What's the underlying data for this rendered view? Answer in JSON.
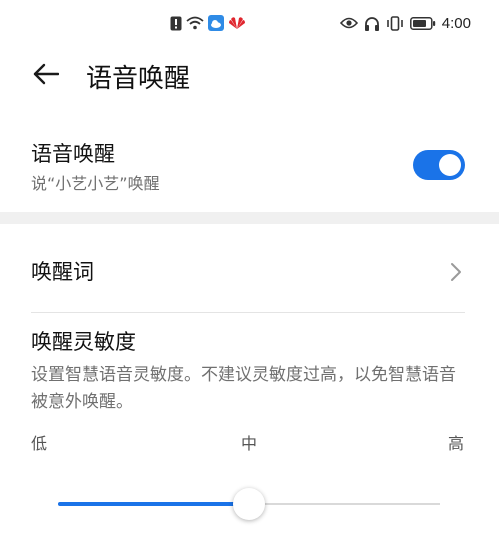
{
  "status_bar": {
    "time": "4:00",
    "left_icons": [
      "alert-card-icon",
      "wifi-icon",
      "weather-app-icon",
      "huawei-logo-icon"
    ],
    "right_icons": [
      "eye-comfort-icon",
      "headphones-icon",
      "vibrate-icon",
      "battery-icon"
    ]
  },
  "header": {
    "title": "语音唤醒",
    "back_icon": "arrow-left-icon"
  },
  "voice_wakeup": {
    "title": "语音唤醒",
    "subtitle": "说“小艺小艺”唤醒",
    "enabled": true,
    "accent_color": "#1a73e8"
  },
  "wake_word": {
    "label": "唤醒词",
    "chevron_icon": "chevron-right-icon"
  },
  "sensitivity": {
    "title": "唤醒灵敏度",
    "description": "设置智慧语音灵敏度。不建议灵敏度过高，以免智慧语音被意外唤醒。",
    "levels": [
      "低",
      "中",
      "高"
    ],
    "value_fraction": 0.5
  }
}
